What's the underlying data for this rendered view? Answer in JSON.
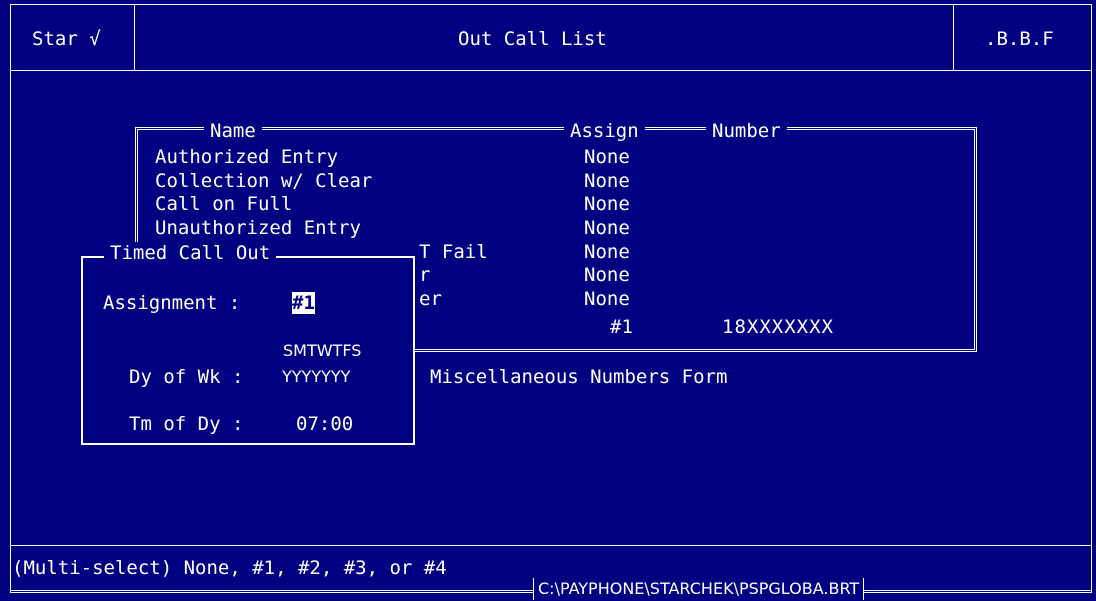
{
  "header": {
    "left": "Star √",
    "title": "Out Call List",
    "right": ".B.B.F"
  },
  "list": {
    "col_name": "Name",
    "col_assign": "Assign",
    "col_number": "Number",
    "rows": [
      {
        "name": "Authorized Entry",
        "assign": "None",
        "number": ""
      },
      {
        "name": "Collection w/ Clear",
        "assign": "None",
        "number": ""
      },
      {
        "name": "Call on Full",
        "assign": "None",
        "number": ""
      },
      {
        "name": "Unauthorized Entry",
        "assign": "None",
        "number": ""
      },
      {
        "name": "T Fail",
        "assign": "None",
        "number": ""
      },
      {
        "name": "r",
        "assign": "None",
        "number": ""
      },
      {
        "name": "er",
        "assign": "None",
        "number": ""
      },
      {
        "name": "",
        "assign": "#1",
        "number": "18XXXXXXX"
      }
    ],
    "footer_label": "Miscellaneous Numbers Form"
  },
  "dialog": {
    "title": "Timed Call Out",
    "assignment_label": "Assignment :",
    "assignment_value": "#1",
    "days_header": "SMTWTFS",
    "dow_label": "Dy of Wk :",
    "dow_value": "YYYYYYY",
    "tod_label": "Tm of Dy :",
    "tod_value": "07:00"
  },
  "status": {
    "hint": "(Multi-select) None, #1, #2, #3, or #4",
    "path": "C:\\PAYPHONE\\STARCHEK\\PSPGLOBA.BRT"
  }
}
